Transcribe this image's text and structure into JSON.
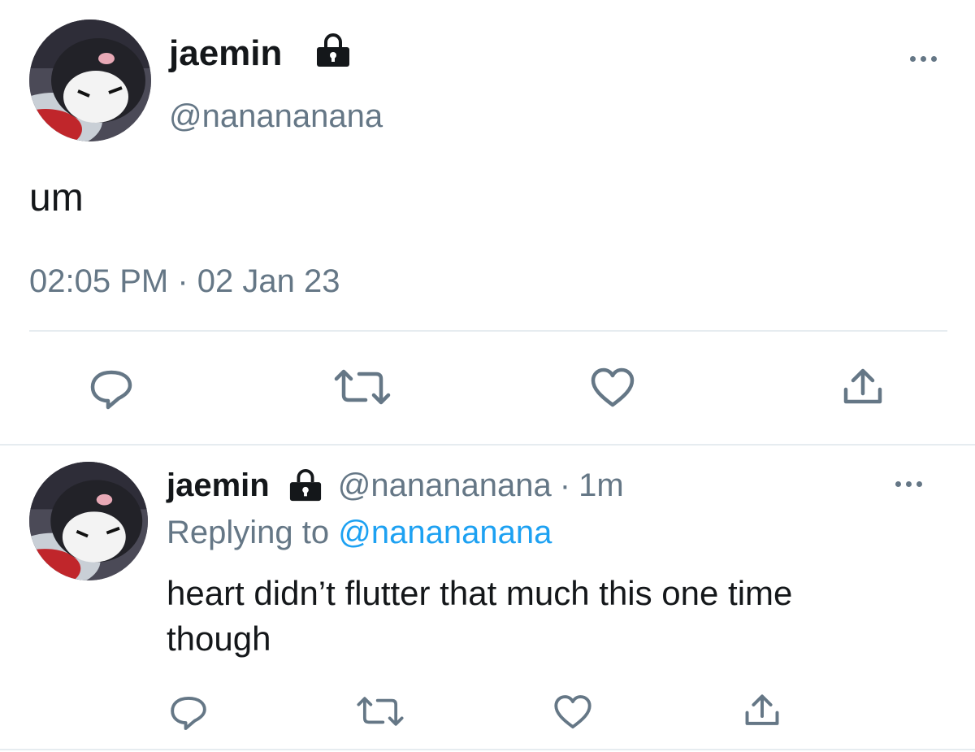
{
  "main_tweet": {
    "display_name": "jaemin",
    "handle": "@nanananana",
    "text": "um",
    "timestamp": "02:05 PM · 02 Jan 23",
    "actions": [
      "reply",
      "retweet",
      "like",
      "share"
    ]
  },
  "reply_tweet": {
    "display_name": "jaemin",
    "handle": "@nanananana",
    "separator": "·",
    "time_ago": "1m",
    "replying_to_label": "Replying to",
    "replying_to_handle": "@nanananana",
    "text": "heart didn’t flutter that much this one time though",
    "actions": [
      "reply",
      "retweet",
      "like",
      "share"
    ]
  },
  "colors": {
    "text_primary": "#14171a",
    "text_secondary": "#657786",
    "link": "#1da1f2",
    "divider": "#e6ecf0"
  }
}
